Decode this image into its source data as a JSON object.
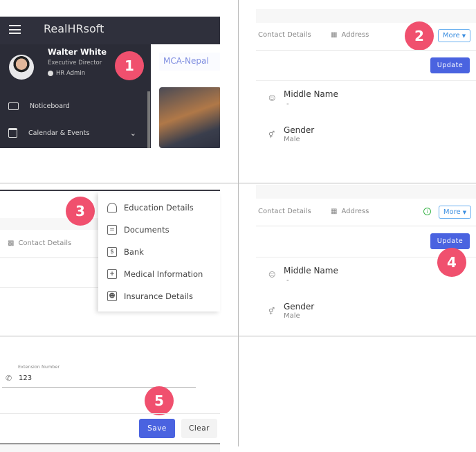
{
  "panel1": {
    "app_title": "RealHRsoft",
    "user_name": "Walter White",
    "user_title": "Executive Director",
    "user_role": "HR Admin",
    "org_name": "MCA-Nepal",
    "menu": [
      {
        "label": "Noticeboard",
        "icon": "noticeboard-icon"
      },
      {
        "label": "Calendar & Events",
        "icon": "calendar-icon"
      }
    ],
    "step": "1"
  },
  "panel2": {
    "tabs": [
      "Contact Details",
      "Address"
    ],
    "more_label": "More",
    "update_label": "Update",
    "fields": [
      {
        "label": "Middle Name",
        "value": "-"
      },
      {
        "label": "Gender",
        "value": "Male"
      }
    ],
    "step": "2"
  },
  "panel3": {
    "tab": "Contact Details",
    "menu": [
      "Education Details",
      "Documents",
      "Bank",
      "Medical Information",
      "Insurance Details"
    ],
    "step": "3"
  },
  "panel4": {
    "tabs": [
      "Contact Details",
      "Address"
    ],
    "more_label": "More",
    "update_label": "Update",
    "fields": [
      {
        "label": "Middle Name",
        "value": "-"
      },
      {
        "label": "Gender",
        "value": "Male"
      }
    ],
    "step": "4",
    "info_color": "#3bb54a"
  },
  "panel5": {
    "field_label": "Extension Number",
    "field_value": "123",
    "save_label": "Save",
    "clear_label": "Clear",
    "step": "5"
  },
  "colors": {
    "badge": "#f0506e",
    "primary": "#4a63e0",
    "sidebar": "#2f303c"
  }
}
